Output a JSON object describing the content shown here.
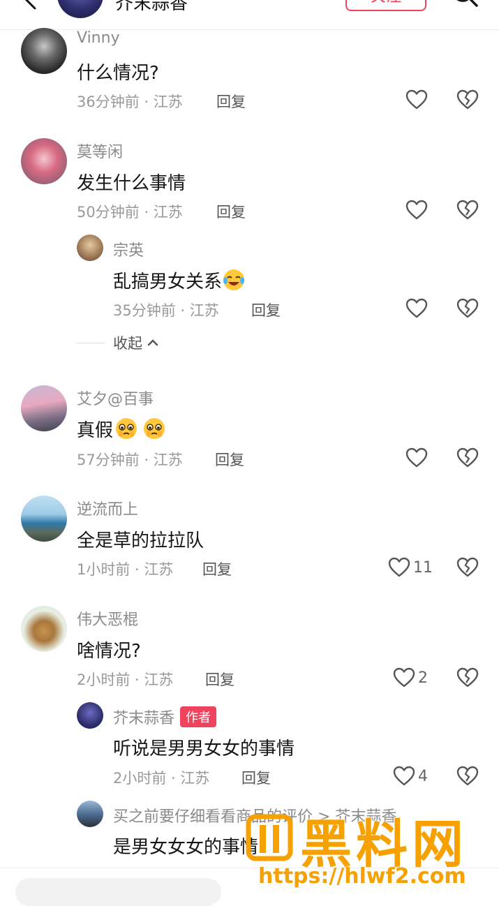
{
  "header": {
    "account_name": "芥末蒜香",
    "follow_label": "关注"
  },
  "comments": [
    {
      "user": "Vinny",
      "text": "什么情况?",
      "time": "36分钟前 · 江苏",
      "reply": "回复",
      "likes": ""
    },
    {
      "user": "莫等闲",
      "text": "发生什么事情",
      "time": "50分钟前 · 江苏",
      "reply": "回复",
      "likes": ""
    },
    {
      "user": "宗英",
      "text": "乱搞男女关系",
      "time": "35分钟前 · 江苏",
      "reply": "回复",
      "likes": ""
    },
    {
      "user": "艾夕@百事",
      "text": "真假",
      "time": "57分钟前 · 江苏",
      "reply": "回复",
      "likes": ""
    },
    {
      "user": "逆流而上",
      "text": "全是草的拉拉队",
      "time": "1小时前 · 江苏",
      "reply": "回复",
      "likes": "11"
    },
    {
      "user": "伟大恶棍",
      "text": "啥情况?",
      "time": "2小时前 · 江苏",
      "reply": "回复",
      "likes": "2"
    },
    {
      "user": "芥末蒜香",
      "badge": "作者",
      "text": "听说是男男女女的事情",
      "time": "2小时前 · 江苏",
      "reply": "回复",
      "likes": "4"
    },
    {
      "user": "买之前要仔细看看商品的评价 > 芥末蒜香",
      "text": "是男女女女的事情"
    }
  ],
  "collapse_label": "收起",
  "watermark": {
    "text": "黑料网",
    "url": "https://hlwf2.com"
  },
  "icons": {
    "like": "heart-outline-icon",
    "dislike": "broken-heart-icon",
    "back": "chevron-left-icon",
    "search": "search-icon",
    "collapse": "chevron-up-icon"
  },
  "colors": {
    "accent": "#f0445e",
    "watermark": "#f6a100",
    "meta": "#999999"
  }
}
